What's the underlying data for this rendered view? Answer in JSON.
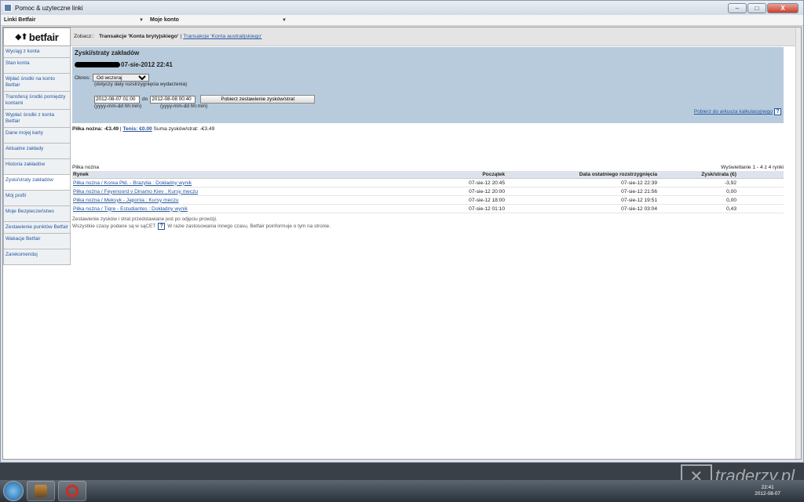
{
  "window": {
    "title": "Pomoc & uzyteczne linki",
    "controls": [
      "–",
      "□",
      "X"
    ]
  },
  "menubar": {
    "links_label": "Linki Betfair",
    "account_label": "Moje konto"
  },
  "logo": {
    "text": "betfair",
    "mark": "◆⬆"
  },
  "sidebar": {
    "items": [
      {
        "label": "Wyciąg z konta"
      },
      {
        "label": "Stan konta"
      },
      {
        "label": "Wpłać środki na konto Betfair"
      },
      {
        "label": "Transferuj środki pomiędzy kontami"
      },
      {
        "label": "Wypłać środki z konta Betfair"
      },
      {
        "label": "Dane mojej karty"
      },
      {
        "label": "Aktualne zakłady"
      },
      {
        "label": "Historia zakładów"
      },
      {
        "label": "Zyski/straty zakładów"
      },
      {
        "label": "Mój profil"
      },
      {
        "label": "Moje Bezpieczeństwo"
      },
      {
        "label": "Zestawienie punktów Betfair"
      },
      {
        "label": "Wakacje Betfair"
      },
      {
        "label": "Zarekomenduj"
      }
    ]
  },
  "breadcrumb": {
    "prefix": "Zobacz::",
    "selected": "Transakcje 'Konta brytyjskiego'",
    "separator": "|",
    "link": "Transakcje 'Konta australijskiego'"
  },
  "panel": {
    "title": "Zyski/straty zakładów",
    "date": "07-sie-2012 22:41",
    "period_label": "Okres:",
    "period_value": "Od wczoraj",
    "period_hint": "(dotyczy daty rozstrzygnięcia wydarzenia)",
    "date_from": "2012-08-07 01:00",
    "to_label": "do",
    "date_to": "2012-08-08 00:40",
    "fetch_button": "Pobierz zestawienie zysków/strat",
    "format_from": "(yyyy-mm-dd hh:mm)",
    "format_to": "(yyyy-mm-dd hh:mm)",
    "download_link": "Pobierz do arkusza kalkulacyjnego",
    "help_icon": "?"
  },
  "sums": {
    "football_label": "Piłka nożna:",
    "football_value": "-€3.49",
    "separator": "|",
    "tennis_label": "Tenis: €0.00",
    "total_label": "Suma zysków/strat:",
    "total_value": "-€3.49"
  },
  "table": {
    "section": "Piłka nożna",
    "showing": "Wyświetlanie 1 - 4 z 4 rynki",
    "headers": [
      "Rynek",
      "Początek",
      "Data ostatniego rozstrzygnięcia",
      "Zysk/strata (€)"
    ],
    "rows": [
      {
        "market": "Piłka nożna / Korea Płd. - Brazylia : Dokładny wynik",
        "start": "07-sie-12 20:45",
        "settled": "07-sie-12 22:39",
        "pl": "-3,92"
      },
      {
        "market": "Piłka nożna / Feyenoord v Dinamo Kiev : Kursy meczu",
        "start": "07-sie-12 20:00",
        "settled": "07-sie-12 21:56",
        "pl": "0,00"
      },
      {
        "market": "Piłka nożna / Meksyk - Japonia : Kursy meczu",
        "start": "07-sie-12 18:00",
        "settled": "07-sie-12 19:51",
        "pl": "0,00"
      },
      {
        "market": "Piłka nożna / Tigre - Estudiantes : Dokładny wynik",
        "start": "07-sie-12 01:10",
        "settled": "07-sie-12 03:04",
        "pl": "0,43"
      }
    ],
    "note1": "Zestawienie zysków i strat przedstawiane jest po odjęciu prowizji.",
    "note2a": "Wszystkie czasy podane są w sąCET",
    "note2b": "W razie zastosowania innego czasu, Betfair poinformuje o tym na stronie."
  },
  "taskbar": {
    "time": "22:41",
    "date": "2012-08-07"
  },
  "watermark": {
    "text": "traderzy.pl"
  },
  "colors": {
    "panel": "#b8cbdc",
    "link": "#2556a0",
    "close": "#c7412d"
  }
}
